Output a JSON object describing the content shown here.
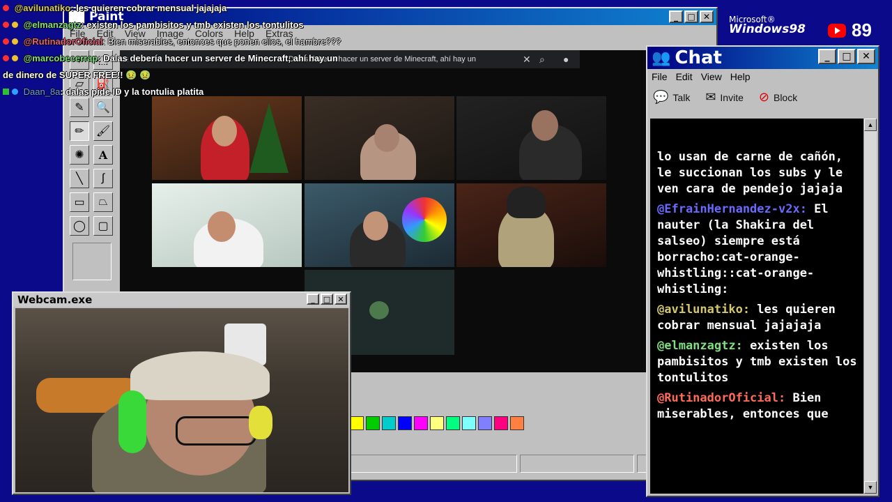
{
  "colors": {
    "desktop": "#0a0a8a",
    "accent": "#000080"
  },
  "paint": {
    "title": "Paint",
    "menu": [
      "File",
      "Edit",
      "View",
      "Image",
      "Colors",
      "Help",
      "Extras"
    ],
    "tools": [
      "select-star-icon",
      "select-rect-icon",
      "eraser-icon",
      "fill-icon",
      "picker-icon",
      "magnifier-icon",
      "pencil-icon",
      "brush-icon",
      "airbrush-icon",
      "text-icon",
      "line-icon",
      "curve-icon",
      "rect-icon",
      "polygon-icon",
      "ellipse-icon",
      "rounded-rect-icon"
    ],
    "palette": [
      "#ffff00",
      "#00cc00",
      "#00cccc",
      "#0000ff",
      "#ff00ff",
      "#ffff80",
      "#00ff80",
      "#80ffff",
      "#8080ff",
      "#ff0080",
      "#ff8040"
    ]
  },
  "browser": {
    "search_text": "Dalas debería hacer un server de Minecraft, ahí hay un",
    "mic_icon": "mic-icon",
    "search_icon": "search-icon",
    "close_icon": "close-icon"
  },
  "overlay_chat": [
    {
      "user": "@avilunatiko",
      "user_color": "#d4c86a",
      "text": ": les quieren cobrar mensual jajajaja"
    },
    {
      "user": "@elmanzagtz",
      "user_color": "#7fe07f",
      "text": ": existen los pambisitos y tmb existen los tontulitos"
    },
    {
      "user": "@RutinadorOficial",
      "user_color": "#e0607a",
      "text": ": Bien miserables, entonces que ponen ellos, el hambre???"
    },
    {
      "user": "@marcobecerrap",
      "user_color": "#7fe07f",
      "text": ": Dalas debería hacer un server de Minecraft, ahí hay un"
    },
    {
      "user": "",
      "user_color": "#ffffff",
      "text": "de dinero de SUPER FREE!! 🤢 🤢"
    },
    {
      "user": "Daan_8a",
      "user_color": "#6aa0ff",
      "text": ": dalas pide ID y la tontulia platita"
    }
  ],
  "chat": {
    "title": "Chat",
    "menu": [
      "File",
      "Edit",
      "View",
      "Help"
    ],
    "toolbar": [
      {
        "label": "Talk",
        "icon": "talk-icon"
      },
      {
        "label": "Invite",
        "icon": "invite-icon"
      },
      {
        "label": "Block",
        "icon": "block-icon"
      }
    ],
    "messages": [
      {
        "user": "",
        "user_color": "#ffffff",
        "text": "lo usan de carne de cañón, le succionan los subs y le ven cara de pendejo jajaja"
      },
      {
        "user": "@EfrainHernandez-v2x:",
        "user_color": "#6a6aff",
        "text": " El nauter (la Shakira del salseo) siempre está borracho:cat-orange-whistling::cat-orange-whistling:"
      },
      {
        "user": "@avilunatiko:",
        "user_color": "#d4c86a",
        "text": " les quieren cobrar mensual jajajaja"
      },
      {
        "user": "@elmanzagtz:",
        "user_color": "#7fe07f",
        "text": " existen los pambisitos y tmb existen los tontulitos"
      },
      {
        "user": "@RutinadorOficial:",
        "user_color": "#ff6a5a",
        "text": " Bien miserables, entonces que"
      }
    ]
  },
  "webcam": {
    "title": "Webcam.exe"
  },
  "brand": {
    "microsoft": "Microsoft®",
    "windows": "Windows98"
  },
  "youtube": {
    "count": "89"
  }
}
